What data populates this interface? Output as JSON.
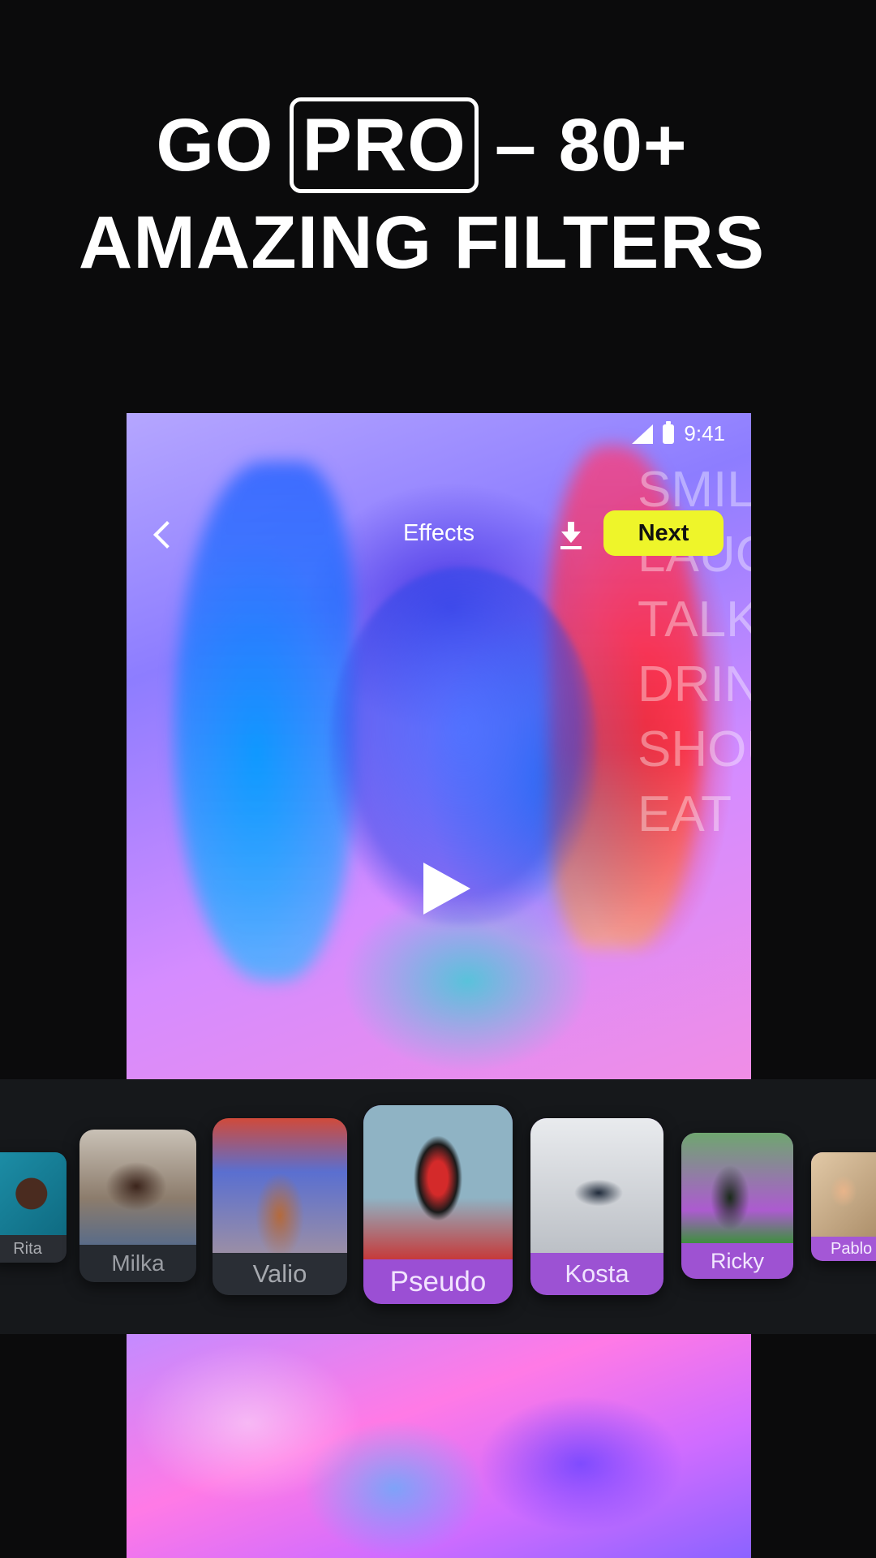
{
  "headline": {
    "line1_prefix": "GO",
    "line1_boxed": "PRO",
    "line1_suffix": "– 80+",
    "line2": "AMAZING FILTERS"
  },
  "preview": {
    "status_time": "9:41",
    "title": "Effects",
    "next_label": "Next",
    "overlay_text": [
      "SMIL",
      "LAUG",
      "TALK",
      "DRIN",
      "SHOU",
      "EAT"
    ]
  },
  "filters": [
    {
      "label": "Rita",
      "selected": false,
      "pro": false
    },
    {
      "label": "Milka",
      "selected": false,
      "pro": false
    },
    {
      "label": "Valio",
      "selected": false,
      "pro": false
    },
    {
      "label": "Pseudo",
      "selected": true,
      "pro": true
    },
    {
      "label": "Kosta",
      "selected": false,
      "pro": true
    },
    {
      "label": "Ricky",
      "selected": false,
      "pro": true
    },
    {
      "label": "Pablo",
      "selected": false,
      "pro": true
    }
  ],
  "colors": {
    "background": "#0b0b0c",
    "next_button": "#eef52a",
    "pro_filter": "#9b4fd4",
    "strip": "#16181b"
  },
  "icons": [
    "signal-icon",
    "battery-icon",
    "back-chevron-icon",
    "download-icon",
    "play-icon"
  ]
}
